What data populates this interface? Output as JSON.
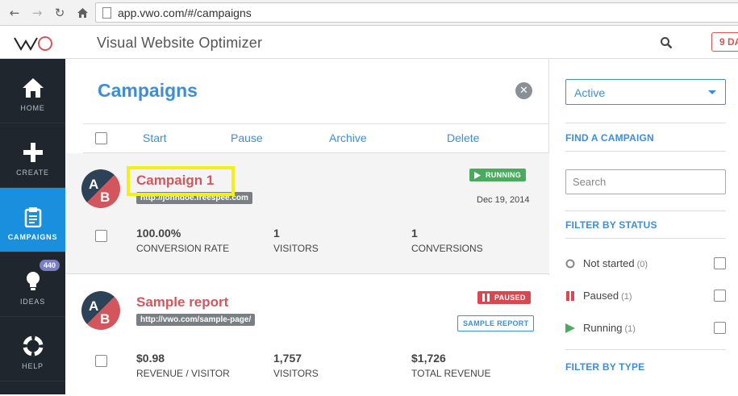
{
  "browser": {
    "url": "app.vwo.com/#/campaigns"
  },
  "header": {
    "app_title": "Visual Website Optimizer",
    "trial_badge": "9 DA"
  },
  "sidebar": {
    "items": [
      {
        "label": "HOME",
        "icon": "home-icon"
      },
      {
        "label": "CREATE",
        "icon": "plus-icon"
      },
      {
        "label": "CAMPAIGNS",
        "icon": "clipboard-icon",
        "active": true
      },
      {
        "label": "IDEAS",
        "icon": "lightbulb-icon",
        "badge": "440"
      },
      {
        "label": "HELP",
        "icon": "lifebuoy-icon"
      }
    ]
  },
  "main": {
    "title": "Campaigns",
    "toolbar": {
      "start": "Start",
      "pause": "Pause",
      "archive": "Archive",
      "delete": "Delete"
    },
    "campaigns": [
      {
        "avatar_a": "A",
        "avatar_b": "B",
        "name": "Campaign 1",
        "url": "http://johndoe.freespee.com",
        "status": "RUNNING",
        "date": "Dec 19, 2014",
        "metrics": [
          {
            "value": "100.00%",
            "label": "CONVERSION RATE"
          },
          {
            "value": "1",
            "label": "VISITORS"
          },
          {
            "value": "1",
            "label": "CONVERSIONS"
          }
        ]
      },
      {
        "avatar_a": "A",
        "avatar_b": "B",
        "name": "Sample report",
        "url": "http://vwo.com/sample-page/",
        "status": "PAUSED",
        "action": "SAMPLE REPORT",
        "metrics": [
          {
            "value": "$0.98",
            "label": "REVENUE / VISITOR"
          },
          {
            "value": "1,757",
            "label": "VISITORS"
          },
          {
            "value": "$1,726",
            "label": "TOTAL REVENUE"
          }
        ]
      }
    ]
  },
  "filters": {
    "status_select": "Active",
    "find_title": "FIND A CAMPAIGN",
    "search_placeholder": "Search",
    "status_title": "FILTER BY STATUS",
    "status_options": [
      {
        "name": "Not started",
        "count": "(0)"
      },
      {
        "name": "Paused",
        "count": "(1)"
      },
      {
        "name": "Running",
        "count": "(1)"
      }
    ],
    "type_title": "FILTER BY TYPE"
  },
  "colors": {
    "accent": "#3d8ed8",
    "sidebar_bg": "#1f262d",
    "sidebar_active": "#1a8fdd",
    "campaign_name": "#d2565c",
    "running": "#4aab5e",
    "paused": "#d9474f",
    "highlight": "#f4ef14"
  }
}
